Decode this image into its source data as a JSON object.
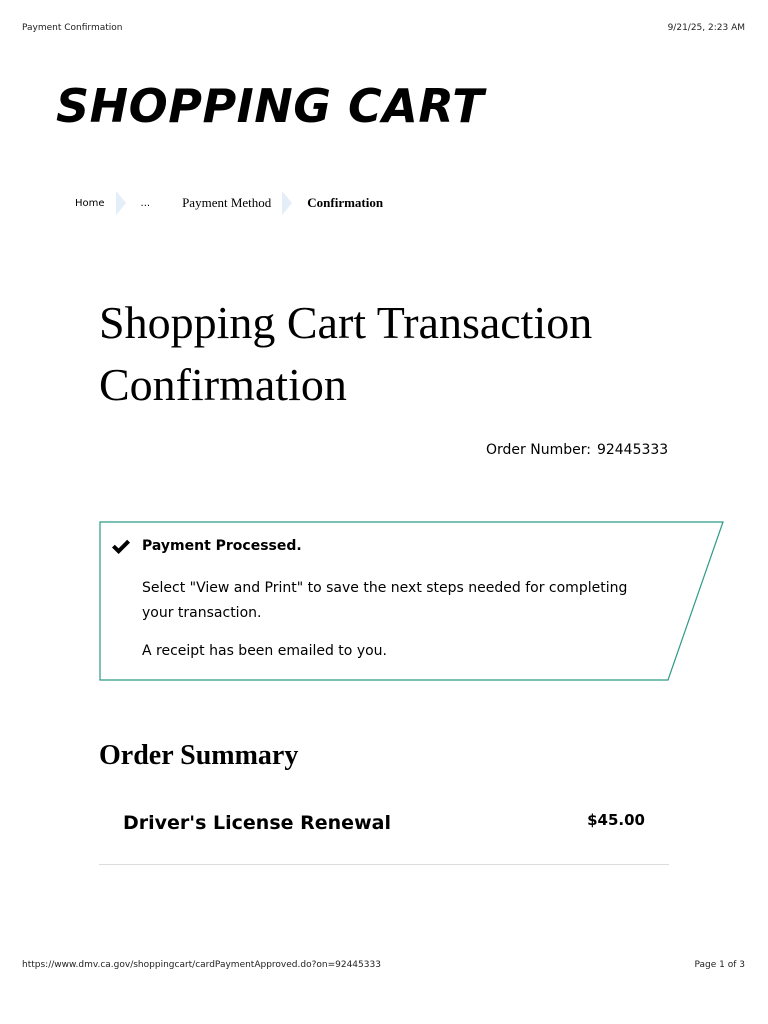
{
  "print_header": {
    "title": "Payment Confirmation",
    "datetime": "9/21/25, 2:23 AM"
  },
  "site_title": "SHOPPING CART",
  "breadcrumb": {
    "home": "Home",
    "ellipsis": "...",
    "payment_method": "Payment Method",
    "current": "Confirmation",
    "separator_color": "#e3eef9"
  },
  "page_heading": "Shopping Cart Transaction Confirmation",
  "order": {
    "label": "Order Number:",
    "number": "92445333"
  },
  "alert": {
    "icon": "checkmark-icon",
    "title": "Payment Processed.",
    "message": "Select \"View and Print\" to save the next steps needed for completing your transaction.",
    "receipt": "A receipt has been emailed to you.",
    "border_color": "#2e9a86"
  },
  "order_summary": {
    "heading": "Order Summary",
    "items": [
      {
        "name": "Driver's License Renewal",
        "price": "$45.00"
      }
    ]
  },
  "print_footer": {
    "url": "https://www.dmv.ca.gov/shoppingcart/cardPaymentApproved.do?on=92445333",
    "page": "Page 1 of 3"
  }
}
